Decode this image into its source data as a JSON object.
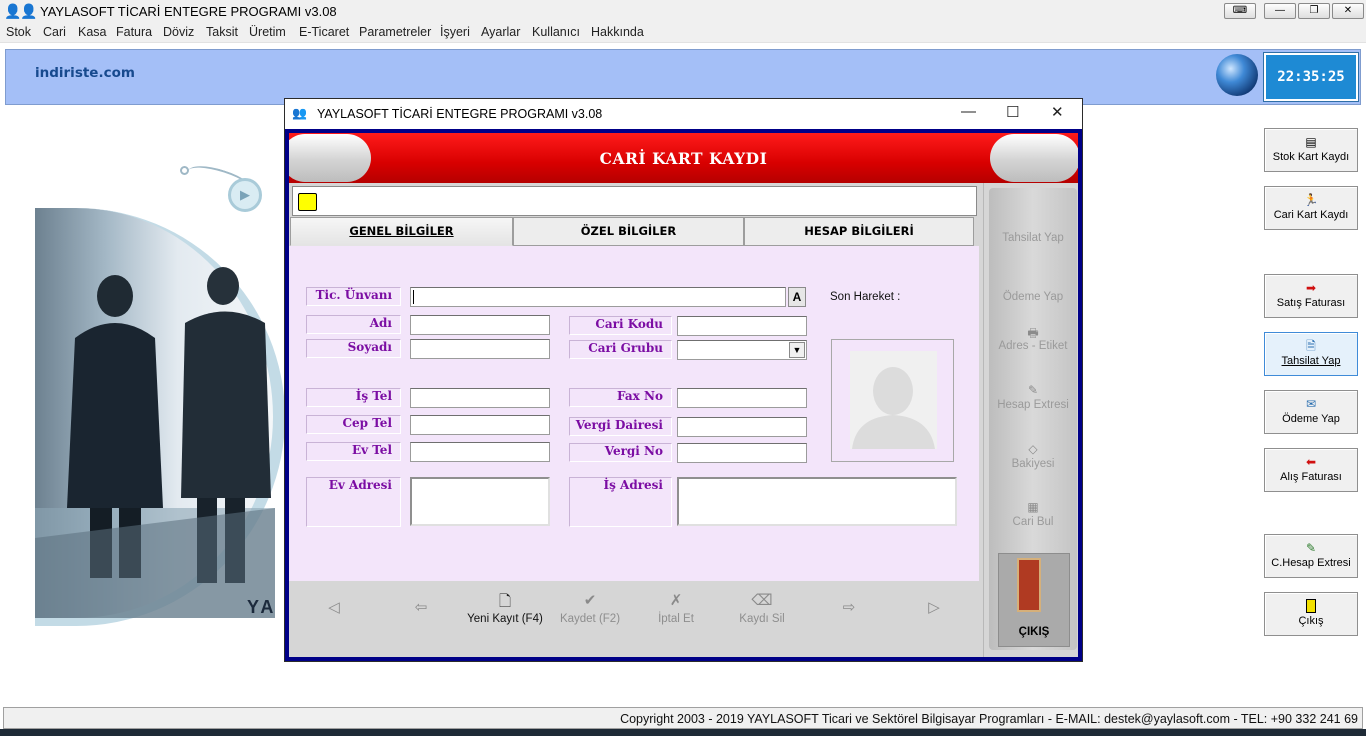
{
  "app": {
    "title": "YAYLASOFT TİCARİ ENTEGRE PROGRAMI v3.08"
  },
  "menu": [
    "Stok",
    "Cari",
    "Kasa",
    "Fatura",
    "Döviz",
    "Taksit",
    "Üretim",
    "E-Ticaret",
    "Parametreler",
    "İşyeri",
    "Ayarlar",
    "Kullanıcı",
    "Hakkında"
  ],
  "banner": {
    "brand": "indiriste.com",
    "clock": "22:35:25"
  },
  "background": {
    "logo_text": "YA"
  },
  "right_toolbar": [
    {
      "label": "Stok Kart Kaydı",
      "icon": "stock-card-icon"
    },
    {
      "label": "Cari Kart Kaydı",
      "icon": "account-card-icon"
    },
    {
      "label": "Satış Faturası",
      "icon": "sales-invoice-icon"
    },
    {
      "label": "Tahsilat Yap",
      "icon": "collection-icon"
    },
    {
      "label": "Ödeme Yap",
      "icon": "payment-icon"
    },
    {
      "label": "Alış Faturası",
      "icon": "purchase-invoice-icon"
    },
    {
      "label": "C.Hesap Extresi",
      "icon": "statement-icon"
    },
    {
      "label": "Çıkış",
      "icon": "exit-icon"
    }
  ],
  "status": {
    "copyright": "Copyright 2003 - 2019 YAYLASOFT Ticari ve Sektörel Bilgisayar Programları  -  E-MAIL: destek@yaylasoft.com  -  TEL: +90 332 241 69"
  },
  "dialog": {
    "title": "YAYLASOFT TİCARİ ENTEGRE PROGRAMI v3.08",
    "header": "CARİ KART KAYDI",
    "tabs": [
      "GENEL BİLGİLER",
      "ÖZEL BİLGİLER",
      "HESAP BİLGİLERİ"
    ],
    "fields": {
      "tic_unvani": "Tic. Ünvanı",
      "adi": "Adı",
      "soyadi": "Soyadı",
      "cari_kodu": "Cari Kodu",
      "cari_grubu": "Cari Grubu",
      "is_tel": "İş Tel",
      "cep_tel": "Cep Tel",
      "ev_tel": "Ev Tel",
      "fax_no": "Fax No",
      "vergi_dairesi": "Vergi Dairesi",
      "vergi_no": "Vergi No",
      "ev_adresi": "Ev Adresi",
      "is_adresi": "İş Adresi"
    },
    "a_button": "A",
    "son_hareket": "Son Hareket :",
    "nav": {
      "yeni": "Yeni Kayıt (F4)",
      "kaydet": "Kaydet (F2)",
      "iptal": "İptal Et",
      "sil": "Kaydı Sil"
    },
    "side": [
      "Tahsilat Yap",
      "Ödeme Yap",
      "Adres - Etiket",
      "Hesap Extresi",
      "Bakiyesi",
      "Cari Bul"
    ],
    "exit": "ÇIKIŞ"
  }
}
